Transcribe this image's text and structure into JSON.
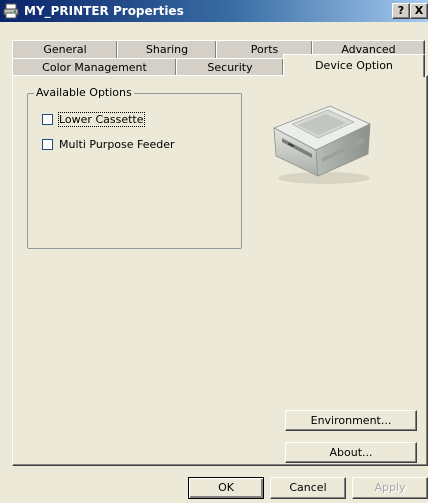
{
  "window": {
    "title": "MY_PRINTER Properties",
    "icon": "printer-icon",
    "help_button": "?",
    "close_button": "X"
  },
  "tabs": {
    "row1": [
      "General",
      "Sharing",
      "Ports",
      "Advanced"
    ],
    "row2": [
      "Color Management",
      "Security",
      "Device Option"
    ],
    "active": "Device Option"
  },
  "device_option": {
    "group_title": "Available Options",
    "options": [
      {
        "label": "Lower Cassette",
        "checked": false
      },
      {
        "label": "Multi Purpose Feeder",
        "checked": false
      }
    ],
    "image": "printer-image",
    "environment_button": "Environment...",
    "about_button": "About..."
  },
  "footer": {
    "ok": "OK",
    "cancel": "Cancel",
    "apply": "Apply"
  },
  "colors": {
    "titlebar_start": "#0a246a",
    "titlebar_end": "#a6caf0",
    "face": "#ece9d8"
  }
}
